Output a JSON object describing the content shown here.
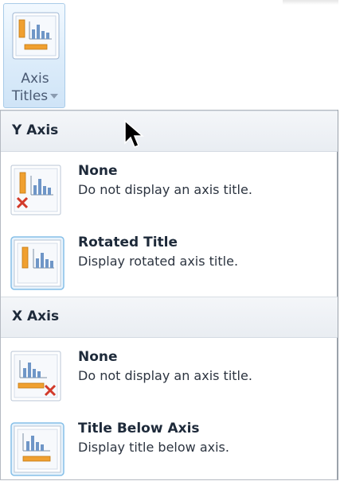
{
  "ribbon_button": {
    "label_line1": "Axis",
    "label_line2": "Titles",
    "icon": "axis-titles-icon",
    "dropdown_icon": "chevron-down-icon"
  },
  "sections": [
    {
      "header": "Y Axis",
      "items": [
        {
          "title": "None",
          "description": "Do not display an axis title.",
          "icon": "y-axis-none-icon"
        },
        {
          "title": "Rotated Title",
          "description": "Display rotated axis title.",
          "icon": "y-axis-rotated-title-icon"
        }
      ]
    },
    {
      "header": "X Axis",
      "items": [
        {
          "title": "None",
          "description": "Do not display an axis title.",
          "icon": "x-axis-none-icon"
        },
        {
          "title": "Title Below Axis",
          "description": "Display title below axis.",
          "icon": "x-axis-title-below-icon"
        }
      ]
    }
  ],
  "colors": {
    "accent_orange": "#f0a030",
    "bar_blue": "#6f96c7",
    "remove_red": "#d23a2a",
    "hover_border": "#86bfe8"
  }
}
